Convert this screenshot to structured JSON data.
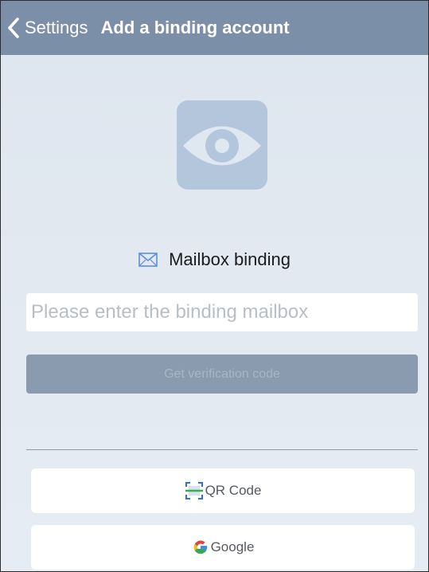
{
  "navbar": {
    "back_label": "Settings",
    "title": "Add a binding account",
    "background": "#7b90a8"
  },
  "logo": {
    "icon": "eye-icon",
    "color": "#b4c6dc"
  },
  "mailbox": {
    "label": "Mailbox binding",
    "icon": "envelope-icon",
    "input_placeholder": "Please enter the binding mailbox",
    "input_value": ""
  },
  "verify_button": {
    "label": "Get verification code",
    "enabled": false
  },
  "third_party": [
    {
      "label": "QR Code",
      "icon": "qr-scan-icon"
    },
    {
      "label": "Google",
      "icon": "google-icon"
    }
  ]
}
